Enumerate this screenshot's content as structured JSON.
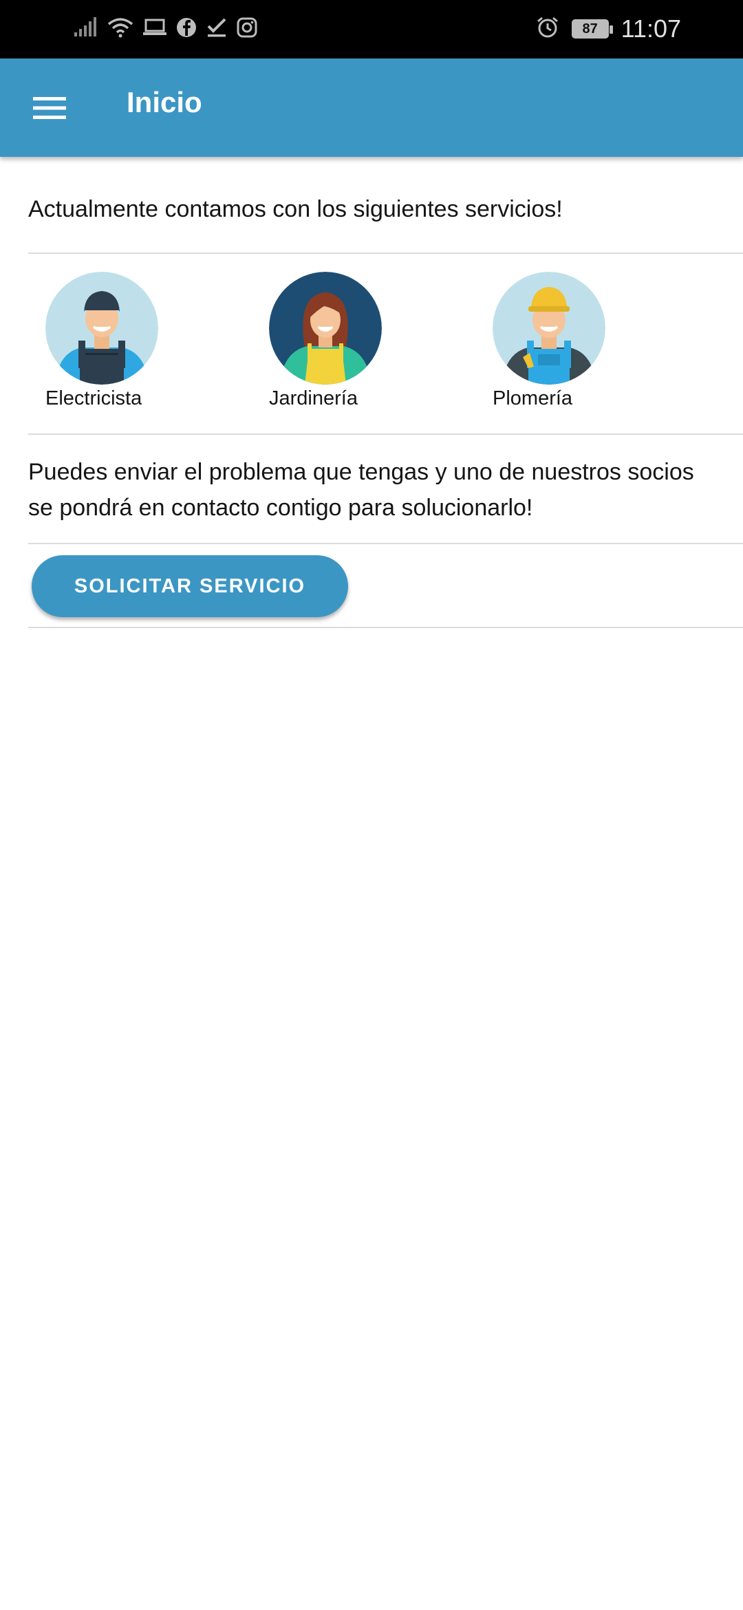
{
  "status_bar": {
    "time": "11:07",
    "battery": "87",
    "icons_left": [
      "signal-icon",
      "wifi-icon",
      "laptop-icon",
      "facebook-icon",
      "check-icon",
      "instagram-icon"
    ],
    "icons_right": [
      "alarm-icon",
      "battery-icon"
    ]
  },
  "app_bar": {
    "title": "Inicio",
    "menu_icon": "hamburger-menu-icon",
    "color": "#3c96c4"
  },
  "intro_text": "Actualmente contamos con los siguientes servicios!",
  "services": [
    {
      "label": "Electricista",
      "avatar_bg": "#bfe0ea"
    },
    {
      "label": "Jardinería",
      "avatar_bg": "#1e4d73"
    },
    {
      "label": "Plomería",
      "avatar_bg": "#bfe0ea"
    }
  ],
  "description": "Puedes enviar el problema que tengas y uno de nuestros socios se pondrá en contacto contigo para solucionarlo!",
  "request_button": "SOLICITAR SERVICIO"
}
